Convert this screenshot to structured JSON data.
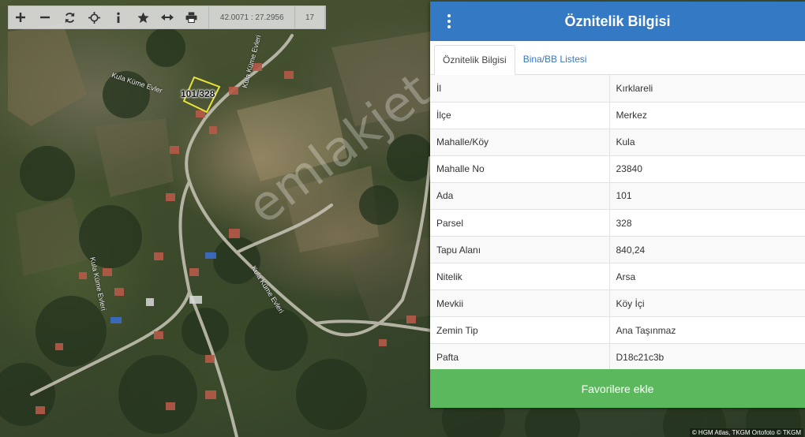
{
  "toolbar": {
    "buttons": [
      {
        "name": "zoom-in",
        "icon": "plus-icon"
      },
      {
        "name": "zoom-out",
        "icon": "minus-icon"
      },
      {
        "name": "refresh",
        "icon": "refresh-icon"
      },
      {
        "name": "locate",
        "icon": "crosshair-icon"
      },
      {
        "name": "info",
        "icon": "info-icon"
      },
      {
        "name": "favorite",
        "icon": "star-icon"
      },
      {
        "name": "measure",
        "icon": "arrows-horizontal-icon"
      },
      {
        "name": "print",
        "icon": "printer-icon"
      }
    ],
    "coordinates": "42.0071 : 27.2956",
    "zoom_level": "17"
  },
  "map": {
    "parcel_label": "101/328",
    "road_labels": [
      "Kula Küme Evler",
      "Kula Küme Evleri",
      "Kula Küme Evleri",
      "Kula Küme Evleri"
    ],
    "watermark": "emlakjet.com",
    "attribution": "© HGM Atlas, TKGM Ortofoto © TKGM"
  },
  "panel": {
    "title": "Öznitelik Bilgisi",
    "header_color": "#3479c4",
    "tabs": [
      {
        "label": "Öznitelik Bilgisi",
        "active": true
      },
      {
        "label": "Bina/BB Listesi",
        "active": false
      }
    ],
    "rows": [
      {
        "key": "İl",
        "value": "Kırklareli"
      },
      {
        "key": "İlçe",
        "value": "Merkez"
      },
      {
        "key": "Mahalle/Köy",
        "value": "Kula"
      },
      {
        "key": "Mahalle No",
        "value": "23840"
      },
      {
        "key": "Ada",
        "value": "101"
      },
      {
        "key": "Parsel",
        "value": "328"
      },
      {
        "key": "Tapu Alanı",
        "value": "840,24"
      },
      {
        "key": "Nitelik",
        "value": "Arsa"
      },
      {
        "key": "Mevkii",
        "value": "Köy İçi"
      },
      {
        "key": "Zemin Tip",
        "value": "Ana Taşınmaz"
      },
      {
        "key": "Pafta",
        "value": "D18c21c3b"
      }
    ],
    "favorite_button": "Favorilere ekle",
    "favorite_color": "#5cb85c"
  }
}
